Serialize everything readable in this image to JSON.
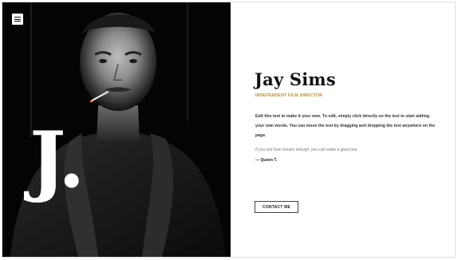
{
  "hero": {
    "monogram": "J.",
    "menu_icon": "hamburger-menu-icon"
  },
  "profile": {
    "name": "Jay Sims",
    "role": "Independent Film Director",
    "bio": "Edit this text to make it your own. To edit, simply click directly on the text to start adding your own words. You can move the text by dragging and dropping the text anywhere on the page.",
    "quote": "If you just love movies enough, you can make a good one.",
    "quote_author": "— Queen T.",
    "contact_label": "Contact Me"
  },
  "colors": {
    "accent": "#b8922a",
    "left_background": "#050505",
    "right_background": "#ffffff"
  }
}
